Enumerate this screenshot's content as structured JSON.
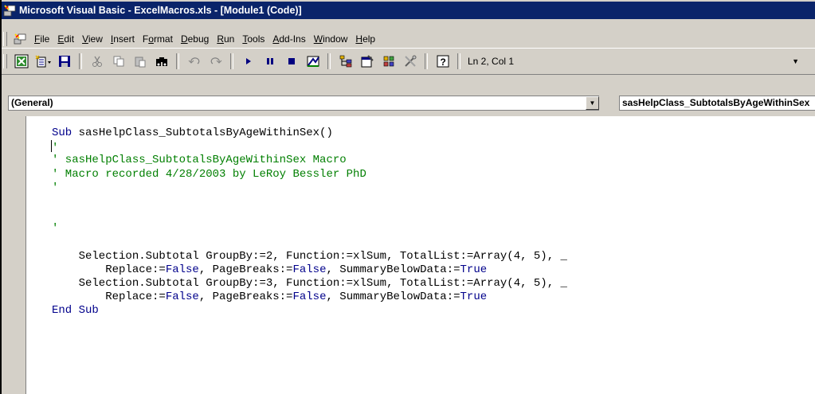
{
  "window": {
    "title": "Microsoft Visual Basic - ExcelMacros.xls - [Module1 (Code)]",
    "app_icon": "vba-app-icon"
  },
  "menu": {
    "items": [
      {
        "label": "File",
        "mnemonic": "F"
      },
      {
        "label": "Edit",
        "mnemonic": "E"
      },
      {
        "label": "View",
        "mnemonic": "V"
      },
      {
        "label": "Insert",
        "mnemonic": "I"
      },
      {
        "label": "Format",
        "mnemonic": "o"
      },
      {
        "label": "Debug",
        "mnemonic": "D"
      },
      {
        "label": "Run",
        "mnemonic": "R"
      },
      {
        "label": "Tools",
        "mnemonic": "T"
      },
      {
        "label": "Add-Ins",
        "mnemonic": "A"
      },
      {
        "label": "Window",
        "mnemonic": "W"
      },
      {
        "label": "Help",
        "mnemonic": "H"
      }
    ]
  },
  "toolbar": {
    "icons": [
      "excel-icon",
      "insert-module-icon",
      "save-icon",
      "cut-icon",
      "copy-icon",
      "paste-icon",
      "find-icon",
      "undo-icon",
      "redo-icon",
      "run-icon",
      "break-icon",
      "reset-icon",
      "design-mode-icon",
      "project-explorer-icon",
      "properties-icon",
      "object-browser-icon",
      "toolbox-icon",
      "help-icon"
    ],
    "cursor_position": "Ln 2, Col 1"
  },
  "code_window": {
    "object_combo": "(General)",
    "procedure_combo": "sasHelpClass_SubtotalsByAgeWithinSex",
    "lines": [
      {
        "parts": [
          {
            "t": "Sub ",
            "c": "kw"
          },
          {
            "t": "sasHelpClass_SubtotalsByAgeWithinSex()",
            "c": ""
          }
        ]
      },
      {
        "parts": [
          {
            "t": "'",
            "c": "cm"
          }
        ],
        "caret": true
      },
      {
        "parts": [
          {
            "t": "' sasHelpClass_SubtotalsByAgeWithinSex Macro",
            "c": "cm"
          }
        ]
      },
      {
        "parts": [
          {
            "t": "' Macro recorded 4/28/2003 by LeRoy Bessler PhD",
            "c": "cm"
          }
        ]
      },
      {
        "parts": [
          {
            "t": "'",
            "c": "cm"
          }
        ]
      },
      {
        "parts": []
      },
      {
        "parts": []
      },
      {
        "parts": [
          {
            "t": "'",
            "c": "cm"
          }
        ]
      },
      {
        "parts": []
      },
      {
        "parts": [
          {
            "t": "    Selection.Subtotal GroupBy:=2, Function:=xlSum, TotalList:=Array(4, 5), _",
            "c": ""
          }
        ]
      },
      {
        "parts": [
          {
            "t": "        Replace:=",
            "c": ""
          },
          {
            "t": "False",
            "c": "kw"
          },
          {
            "t": ", PageBreaks:=",
            "c": ""
          },
          {
            "t": "False",
            "c": "kw"
          },
          {
            "t": ", SummaryBelowData:=",
            "c": ""
          },
          {
            "t": "True",
            "c": "kw"
          }
        ]
      },
      {
        "parts": [
          {
            "t": "    Selection.Subtotal GroupBy:=3, Function:=xlSum, TotalList:=Array(4, 5), _",
            "c": ""
          }
        ]
      },
      {
        "parts": [
          {
            "t": "        Replace:=",
            "c": ""
          },
          {
            "t": "False",
            "c": "kw"
          },
          {
            "t": ", PageBreaks:=",
            "c": ""
          },
          {
            "t": "False",
            "c": "kw"
          },
          {
            "t": ", SummaryBelowData:=",
            "c": ""
          },
          {
            "t": "True",
            "c": "kw"
          }
        ]
      },
      {
        "parts": [
          {
            "t": "End Sub",
            "c": "kw"
          }
        ]
      }
    ]
  },
  "colors": {
    "title_bar": "#0a246a",
    "keyword": "#00008b",
    "comment": "#007f00",
    "chrome": "#d4d0c8"
  }
}
